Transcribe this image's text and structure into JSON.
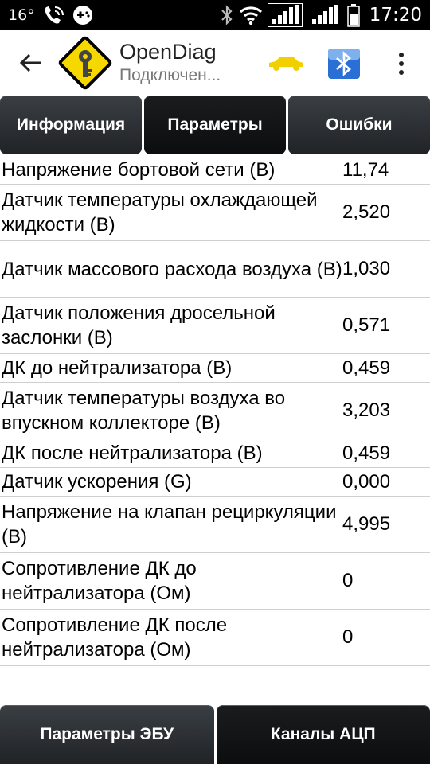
{
  "status_bar": {
    "temperature": "16°",
    "time": "17:20",
    "icons": [
      "phone-wifi-call-icon",
      "game-controller-icon",
      "bluetooth-icon",
      "wifi-icon",
      "signal-icon",
      "signal-icon",
      "battery-icon"
    ]
  },
  "action_bar": {
    "title": "OpenDiag",
    "subtitle": "Подключен...",
    "icons": [
      "back-arrow-icon",
      "app-logo-icon",
      "car-icon",
      "bluetooth-icon",
      "overflow-menu-icon"
    ]
  },
  "tabs": [
    {
      "label": "Информация",
      "active": false
    },
    {
      "label": "Параметры",
      "active": true
    },
    {
      "label": "Ошибки",
      "active": false
    }
  ],
  "parameters": [
    {
      "name": "Напряжение бортовой сети (В)",
      "value": "11,74"
    },
    {
      "name": "Датчик температуры охлаждающей жидкости (В)",
      "value": "2,520"
    },
    {
      "name": "Датчик массового расхода воздуха (В)",
      "value": "1,030"
    },
    {
      "name": "Датчик положения дросельной заслонки (В)",
      "value": "0,571"
    },
    {
      "name": "ДК до нейтрализатора (В)",
      "value": "0,459"
    },
    {
      "name": "Датчик температуры воздуха во впускном коллекторе (В)",
      "value": "3,203"
    },
    {
      "name": "ДК после нейтрализатора (В)",
      "value": "0,459"
    },
    {
      "name": "Датчик ускорения (G)",
      "value": "0,000"
    },
    {
      "name": "Напряжение на клапан рециркуляции (В)",
      "value": "4,995"
    },
    {
      "name": "Сопротивление ДК до нейтрализатора (Ом)",
      "value": "0"
    },
    {
      "name": "Сопротивление ДК после нейтрализатора (Ом)",
      "value": "0"
    }
  ],
  "bottom_buttons": [
    {
      "label": "Параметры ЭБУ"
    },
    {
      "label": "Каналы АЦП"
    }
  ],
  "colors": {
    "tab_bg": "#2b2f33",
    "tab_active_bg": "#121416",
    "logo_yellow": "#f5d800",
    "car_yellow": "#f2d000",
    "bt_blue": "#2a6fd6"
  }
}
